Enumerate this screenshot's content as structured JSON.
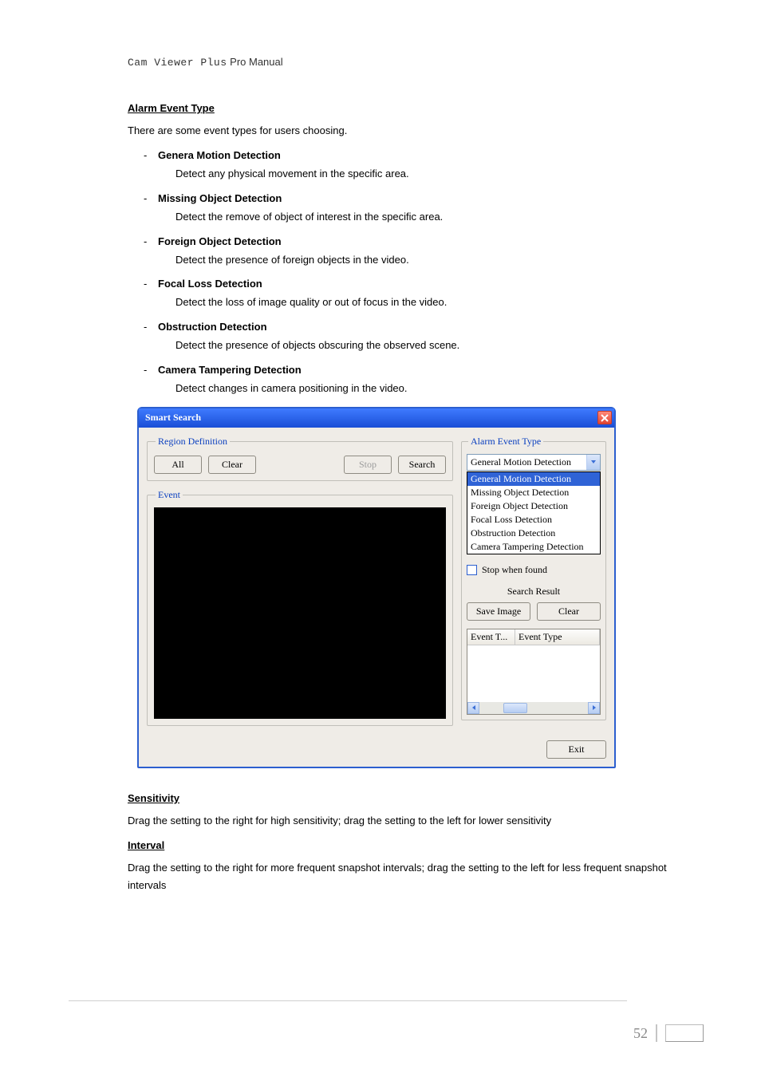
{
  "header": {
    "mono": "Cam Viewer Plus",
    "rest": " Pro Manual"
  },
  "sections": {
    "alarm_heading": "Alarm Event Type",
    "alarm_intro": "There are some event types for users choosing.",
    "types": [
      {
        "title": "Genera Motion Detection",
        "desc": "Detect any physical movement in the specific area."
      },
      {
        "title": "Missing Object Detection",
        "desc": "Detect the remove of object of interest in the specific area."
      },
      {
        "title": "Foreign Object Detection",
        "desc": "Detect the presence of foreign objects in the video."
      },
      {
        "title": "Focal Loss Detection",
        "desc": "Detect the loss of image quality or out of focus in the video."
      },
      {
        "title": "Obstruction Detection",
        "desc": "Detect the presence of objects obscuring the observed scene."
      },
      {
        "title": "Camera Tampering Detection",
        "desc": "Detect changes in camera positioning in the video."
      }
    ],
    "sensitivity_heading": "Sensitivity",
    "sensitivity_body": "Drag the setting to the right for high sensitivity; drag the setting to the left for lower sensitivity",
    "interval_heading": "Interval",
    "interval_body": "Drag the setting to the right for more frequent snapshot intervals; drag the setting to the left for less frequent snapshot intervals"
  },
  "dialog": {
    "title": "Smart Search",
    "region_legend": "Region Definition",
    "event_legend": "Event",
    "alarm_legend": "Alarm Event Type",
    "buttons": {
      "all": "All",
      "clear": "Clear",
      "stop": "Stop",
      "search": "Search",
      "save_image": "Save Image",
      "clear2": "Clear",
      "exit": "Exit"
    },
    "combo_selected": "General Motion Detection",
    "combo_options": [
      "General Motion Detection",
      "Missing Object Detection",
      "Foreign Object Detection",
      "Focal Loss Detection",
      "Obstruction Detection",
      "Camera Tampering Detection"
    ],
    "stop_when_found": "Stop when found",
    "search_result_label": "Search Result",
    "table_headers": {
      "c1": "Event T...",
      "c2": "Event Type"
    }
  },
  "page_number": "52"
}
